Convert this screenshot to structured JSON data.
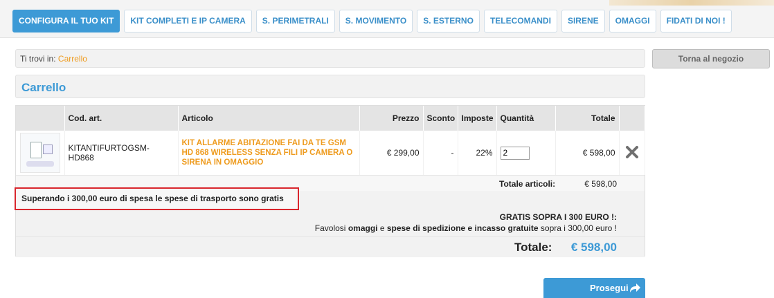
{
  "nav": {
    "tabs": [
      {
        "label": "CONFIGURA IL TUO KIT",
        "active": true
      },
      {
        "label": "KIT COMPLETI E IP CAMERA"
      },
      {
        "label": "S. PERIMETRALI"
      },
      {
        "label": "S. MOVIMENTO"
      },
      {
        "label": "S. ESTERNO"
      },
      {
        "label": "TELECOMANDI"
      },
      {
        "label": "SIRENE"
      },
      {
        "label": "OMAGGI"
      },
      {
        "label": "FIDATI DI NOI !"
      }
    ]
  },
  "breadcrumb": {
    "prefix": "Ti trovi in:",
    "current": "Carrello"
  },
  "back_button": "Torna al negozio",
  "page_title": "Carrello",
  "cart": {
    "headers": {
      "code": "Cod. art.",
      "article": "Articolo",
      "price": "Prezzo",
      "discount": "Sconto",
      "tax": "Imposte",
      "quantity": "Quantità",
      "total": "Totale"
    },
    "items": [
      {
        "code": "KITANTIFURTOGSM-HD868",
        "name": "KIT ALLARME ABITAZIONE FAI DA TE GSM HD 868 WIRELESS SENZA FILI IP CAMERA O SIRENA IN OMAGGIO",
        "price": "€ 299,00",
        "discount": "-",
        "tax": "22%",
        "quantity": "2",
        "total": "€ 598,00"
      }
    ],
    "items_total_label": "Totale articoli:",
    "items_total_value": "€ 598,00",
    "shipping_notice": "Superando i 300,00 euro di spesa le spese di trasporto sono gratis",
    "promo_line1": "GRATIS SOPRA I 300 EURO !:",
    "promo_line2": {
      "t1": "Favolosi ",
      "b1": "omaggi",
      "t2": " e ",
      "b2": "spese di spedizione e incasso gratuite",
      "t3": " sopra i 300,00 euro !"
    },
    "grand_total_label": "Totale:",
    "grand_total_value": "€ 598,00"
  },
  "proceed_button": "Prosegui",
  "colors": {
    "accent": "#3d9ad6",
    "link": "#ee9b1e",
    "notice_border": "#d9262d"
  }
}
